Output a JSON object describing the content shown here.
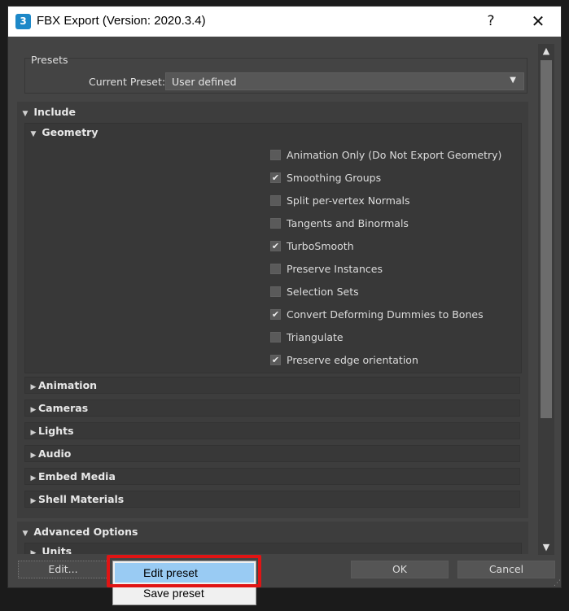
{
  "window": {
    "title": "FBX Export (Version: 2020.3.4)",
    "app_icon_text": "3",
    "help_label": "?",
    "close_label": "✕"
  },
  "presets": {
    "title": "Presets",
    "current_label": "Current Preset:",
    "current_value": "User defined"
  },
  "include": {
    "label": "Include",
    "geometry": {
      "label": "Geometry",
      "options": [
        {
          "label": "Animation Only (Do Not Export Geometry)",
          "checked": false
        },
        {
          "label": "Smoothing Groups",
          "checked": true
        },
        {
          "label": "Split per-vertex Normals",
          "checked": false
        },
        {
          "label": "Tangents and Binormals",
          "checked": false
        },
        {
          "label": "TurboSmooth",
          "checked": true
        },
        {
          "label": "Preserve Instances",
          "checked": false
        },
        {
          "label": "Selection Sets",
          "checked": false
        },
        {
          "label": "Convert Deforming Dummies to Bones",
          "checked": true
        },
        {
          "label": "Triangulate",
          "checked": false
        },
        {
          "label": "Preserve edge orientation",
          "checked": true
        }
      ]
    },
    "subsections": [
      "Animation",
      "Cameras",
      "Lights",
      "Audio",
      "Embed Media",
      "Shell Materials"
    ]
  },
  "advanced": {
    "label": "Advanced Options",
    "units_label": "Units"
  },
  "footer": {
    "edit_label": "Edit...",
    "ok_label": "OK",
    "cancel_label": "Cancel"
  },
  "context_menu": {
    "items": [
      "Edit preset",
      "Save preset"
    ]
  },
  "colors": {
    "highlight": "#e01414",
    "menu_selected": "#99cbf3"
  }
}
